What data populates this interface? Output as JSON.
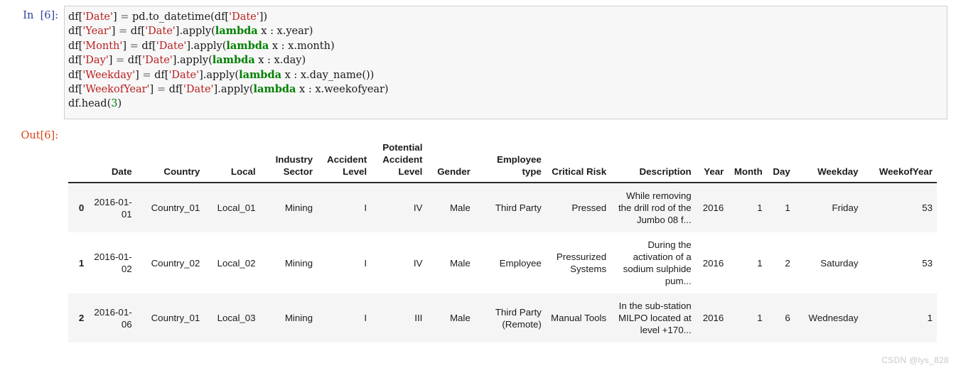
{
  "cell": {
    "in_prompt": "In  [6]:",
    "out_prompt": "Out[6]:",
    "code_lines": [
      "df['Date'] = pd.to_datetime(df['Date'])",
      "df['Year'] = df['Date'].apply(lambda x : x.year)",
      "df['Month'] = df['Date'].apply(lambda x : x.month)",
      "df['Day'] = df['Date'].apply(lambda x : x.day)",
      "df['Weekday'] = df['Date'].apply(lambda x : x.day_name())",
      "df['WeekofYear'] = df['Date'].apply(lambda x : x.weekofyear)",
      "df.head(3)"
    ],
    "code_tokens": {
      "string_date": "'Date'",
      "string_year": "'Year'",
      "string_month": "'Month'",
      "string_day": "'Day'",
      "string_weekday": "'Weekday'",
      "string_weekofyear": "'WeekofYear'",
      "keyword_lambda": "lambda",
      "number_three": "3"
    }
  },
  "table": {
    "index_header": "",
    "columns": [
      "Date",
      "Country",
      "Local",
      "Industry Sector",
      "Accident Level",
      "Potential Accident Level",
      "Gender",
      "Employee type",
      "Critical Risk",
      "Description",
      "Year",
      "Month",
      "Day",
      "Weekday",
      "WeekofYear"
    ],
    "rows": [
      {
        "index": "0",
        "cells": [
          "2016-01-01",
          "Country_01",
          "Local_01",
          "Mining",
          "I",
          "IV",
          "Male",
          "Third Party",
          "Pressed",
          "While removing the drill rod of the Jumbo 08 f...",
          "2016",
          "1",
          "1",
          "Friday",
          "53"
        ]
      },
      {
        "index": "1",
        "cells": [
          "2016-01-02",
          "Country_02",
          "Local_02",
          "Mining",
          "I",
          "IV",
          "Male",
          "Employee",
          "Pressurized Systems",
          "During the activation of a sodium sulphide pum...",
          "2016",
          "1",
          "2",
          "Saturday",
          "53"
        ]
      },
      {
        "index": "2",
        "cells": [
          "2016-01-06",
          "Country_01",
          "Local_03",
          "Mining",
          "I",
          "III",
          "Male",
          "Third Party (Remote)",
          "Manual Tools",
          "In the sub-station MILPO located at level +170...",
          "2016",
          "1",
          "6",
          "Wednesday",
          "1"
        ]
      }
    ]
  },
  "watermark": {
    "text": "CSDN @lys_828"
  },
  "colors": {
    "prompt_in": "#303F9F",
    "prompt_out": "#D84315",
    "string": "#BA2121",
    "keyword": "#008000",
    "number": "#008000",
    "code_bg": "#f7f7f7",
    "code_border": "#cfcfcf",
    "row_stripe": "#f5f5f5",
    "header_rule": "#2b2b2b",
    "watermark": "#c8c8c8"
  }
}
